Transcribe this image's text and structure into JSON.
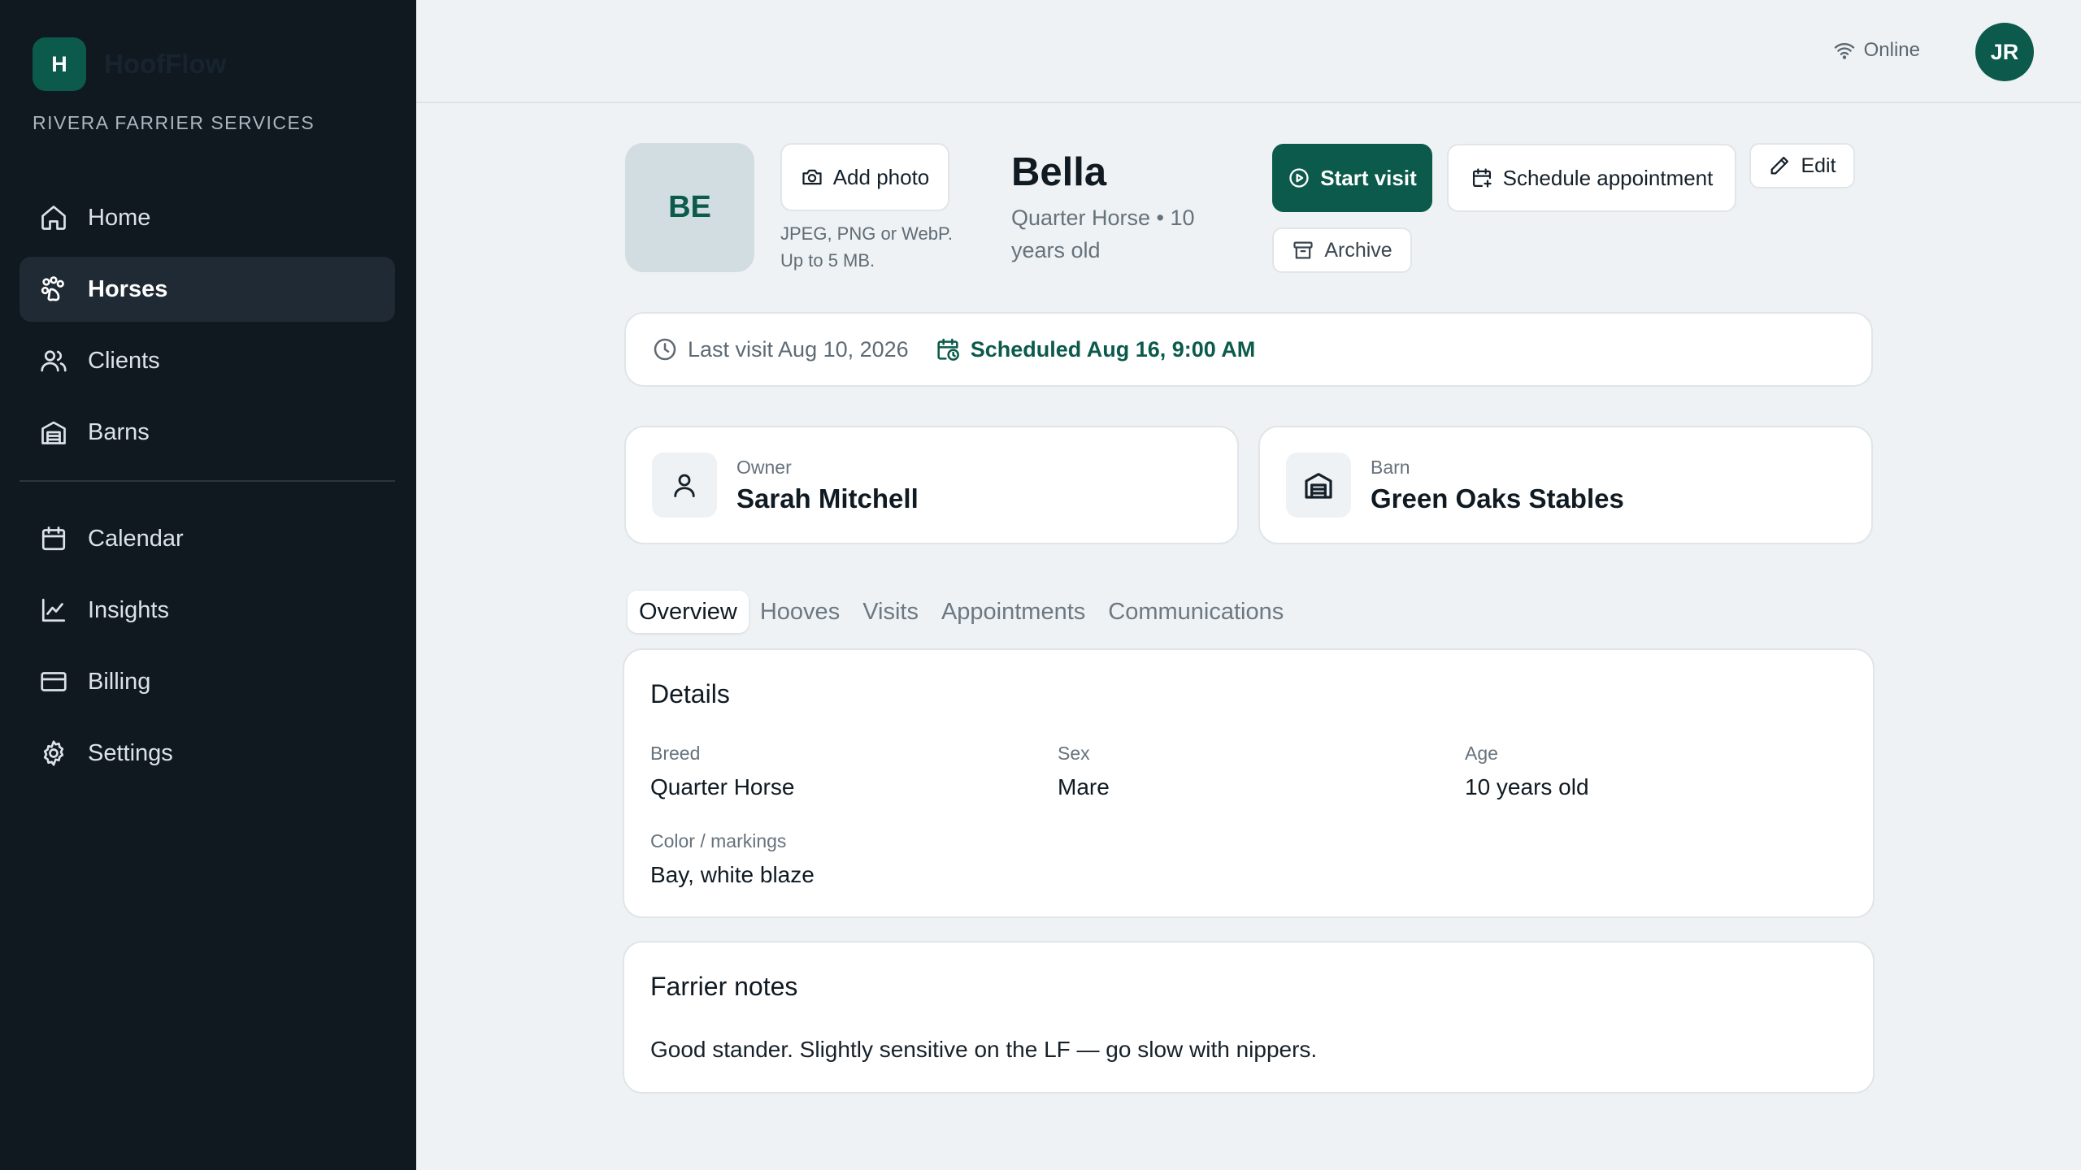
{
  "app": {
    "brand_initial": "H",
    "brand_name": "HoofFlow",
    "business_name": "RIVERA FARRIER SERVICES"
  },
  "sidebar": {
    "primary": [
      {
        "label": "Home",
        "icon": "home-icon"
      },
      {
        "label": "Horses",
        "icon": "horse-icon",
        "active": true
      },
      {
        "label": "Clients",
        "icon": "users-icon"
      },
      {
        "label": "Barns",
        "icon": "barn-icon"
      }
    ],
    "secondary": [
      {
        "label": "Calendar",
        "icon": "calendar-icon"
      },
      {
        "label": "Insights",
        "icon": "chart-icon"
      },
      {
        "label": "Billing",
        "icon": "credit-card-icon"
      },
      {
        "label": "Settings",
        "icon": "gear-icon"
      }
    ]
  },
  "topbar": {
    "status": "Online",
    "user_initials": "JR"
  },
  "horse": {
    "initials": "BE",
    "name": "Bella",
    "subtitle": "Quarter Horse • 10 years old",
    "add_photo_label": "Add photo",
    "photo_hint": "JPEG, PNG or WebP. Up to 5 MB.",
    "actions": {
      "start_visit": "Start visit",
      "schedule": "Schedule appointment",
      "edit": "Edit",
      "archive": "Archive"
    }
  },
  "visit_bar": {
    "last_visit": "Last visit Aug 10, 2026",
    "scheduled": "Scheduled Aug 16, 9:00 AM"
  },
  "owner": {
    "label": "Owner",
    "value": "Sarah Mitchell"
  },
  "barn": {
    "label": "Barn",
    "value": "Green Oaks Stables"
  },
  "tabs": [
    {
      "label": "Overview",
      "active": true
    },
    {
      "label": "Hooves"
    },
    {
      "label": "Visits"
    },
    {
      "label": "Appointments"
    },
    {
      "label": "Communications"
    }
  ],
  "details": {
    "title": "Details",
    "breed": {
      "label": "Breed",
      "value": "Quarter Horse"
    },
    "sex": {
      "label": "Sex",
      "value": "Mare"
    },
    "age": {
      "label": "Age",
      "value": "10 years old"
    },
    "color": {
      "label": "Color / markings",
      "value": "Bay, white blaze"
    }
  },
  "notes": {
    "title": "Farrier notes",
    "text": "Good stander. Slightly sensitive on the LF — go slow with nippers."
  },
  "colors": {
    "accent": "#0b5a4c",
    "sidebar_bg": "#101820",
    "page_bg": "#eef2f4"
  }
}
